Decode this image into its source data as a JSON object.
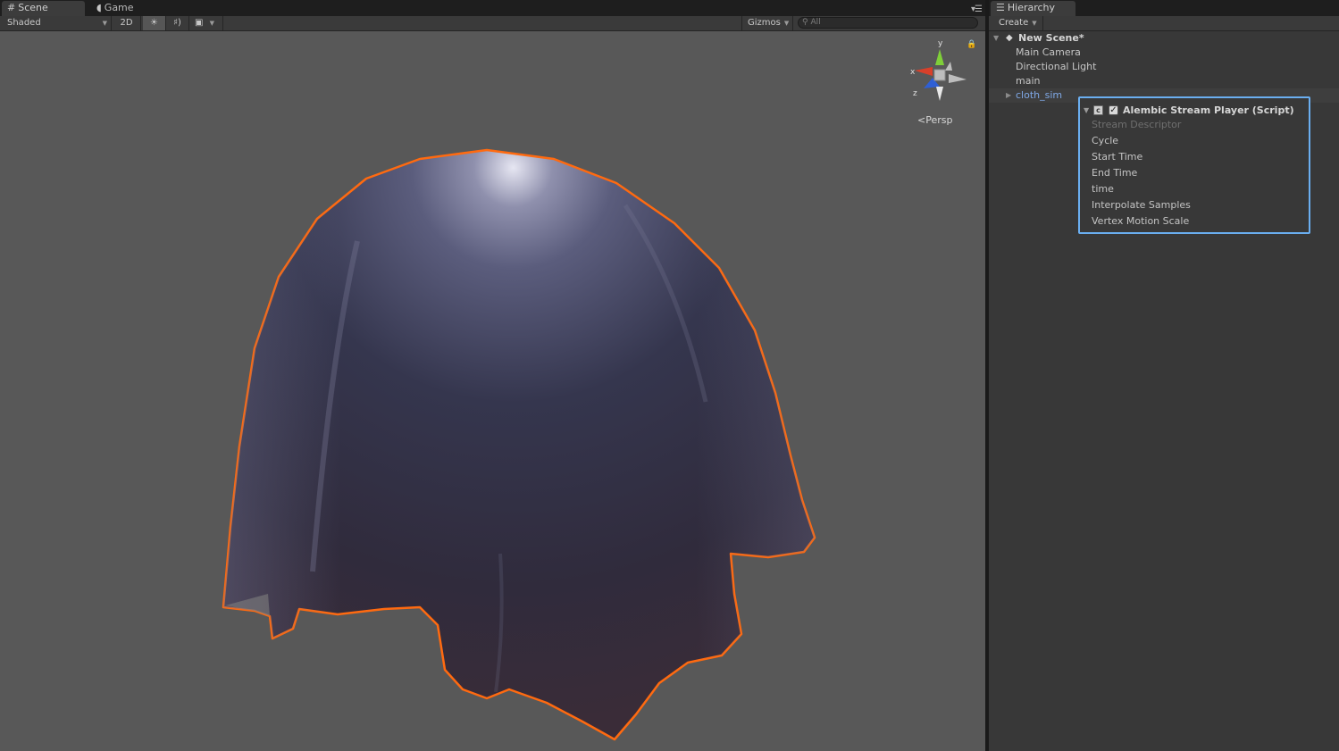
{
  "scene_panel": {
    "tabs": [
      {
        "label": "Scene",
        "icon": "grid-icon",
        "active": true
      },
      {
        "label": "Game",
        "icon": "pacman-icon",
        "active": false
      }
    ],
    "toolbar": {
      "shading_mode": "Shaded",
      "mode_2d": "2D",
      "lighting_icon": "sun-icon",
      "audio_icon": "speaker-icon",
      "effects_icon": "image-icon",
      "gizmos_label": "Gizmos",
      "search_placeholder": "All"
    },
    "view_gizmo": {
      "axis_y": "y",
      "axis_x": "x",
      "axis_z": "z",
      "projection_label": "Persp"
    },
    "selection_outline_color": "#ff6a10"
  },
  "hierarchy_panel": {
    "tab_label": "Hierarchy",
    "create_label": "Create",
    "scene_name": "New Scene*",
    "items": [
      {
        "label": "Main Camera"
      },
      {
        "label": "Directional Light"
      },
      {
        "label": "main"
      },
      {
        "label": "cloth_sim"
      }
    ]
  },
  "popup": {
    "title": "Alembic Stream Player (Script)",
    "enabled": true,
    "properties": [
      {
        "label": "Stream Descriptor",
        "disabled": true
      },
      {
        "label": "Cycle",
        "disabled": false
      },
      {
        "label": "Start Time",
        "disabled": false
      },
      {
        "label": "End Time",
        "disabled": false
      },
      {
        "label": "time",
        "disabled": false
      },
      {
        "label": "Interpolate Samples",
        "disabled": false
      },
      {
        "label": "Vertex Motion Scale",
        "disabled": false
      }
    ],
    "border_color": "#6aaef0"
  }
}
